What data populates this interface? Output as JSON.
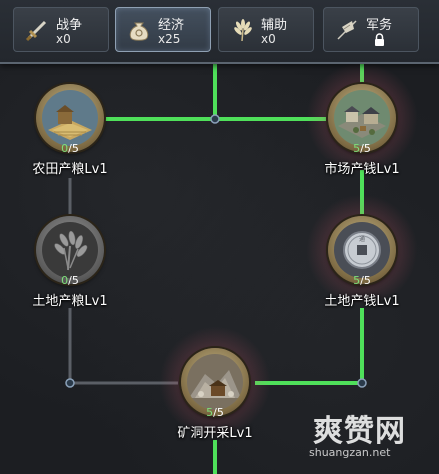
{
  "tabs": [
    {
      "label": "战争",
      "count": "x0",
      "icon": "sword-icon",
      "locked": false,
      "active": false
    },
    {
      "label": "经济",
      "count": "x25",
      "icon": "money-bag-icon",
      "locked": false,
      "active": true
    },
    {
      "label": "辅助",
      "count": "x0",
      "icon": "wheat-icon",
      "locked": false,
      "active": false
    },
    {
      "label": "军务",
      "count": "",
      "icon": "flag-icon",
      "locked": true,
      "active": false
    }
  ],
  "nodes": [
    {
      "id": "farm-grain",
      "name": "农田产粮Lv1",
      "current": "0",
      "max": "5",
      "locked": false,
      "glow": false,
      "icon": "farm-icon"
    },
    {
      "id": "market-money",
      "name": "市场产钱Lv1",
      "current": "5",
      "max": "5",
      "locked": false,
      "glow": true,
      "icon": "market-icon"
    },
    {
      "id": "land-grain",
      "name": "土地产粮Lv1",
      "current": "0",
      "max": "5",
      "locked": true,
      "glow": false,
      "icon": "wheat-icon"
    },
    {
      "id": "land-money",
      "name": "土地产钱Lv1",
      "current": "5",
      "max": "5",
      "locked": false,
      "glow": true,
      "icon": "coin-icon"
    },
    {
      "id": "mine",
      "name": "矿洞开采Lv1",
      "current": "5",
      "max": "5",
      "locked": false,
      "glow": true,
      "icon": "mine-icon"
    }
  ],
  "watermark": {
    "big": "爽赞网",
    "small": "shuangzan.net"
  },
  "colors": {
    "active_line": "#4fe05a",
    "inactive_line": "#5b5f66",
    "progress_done": "#7ee07a"
  }
}
